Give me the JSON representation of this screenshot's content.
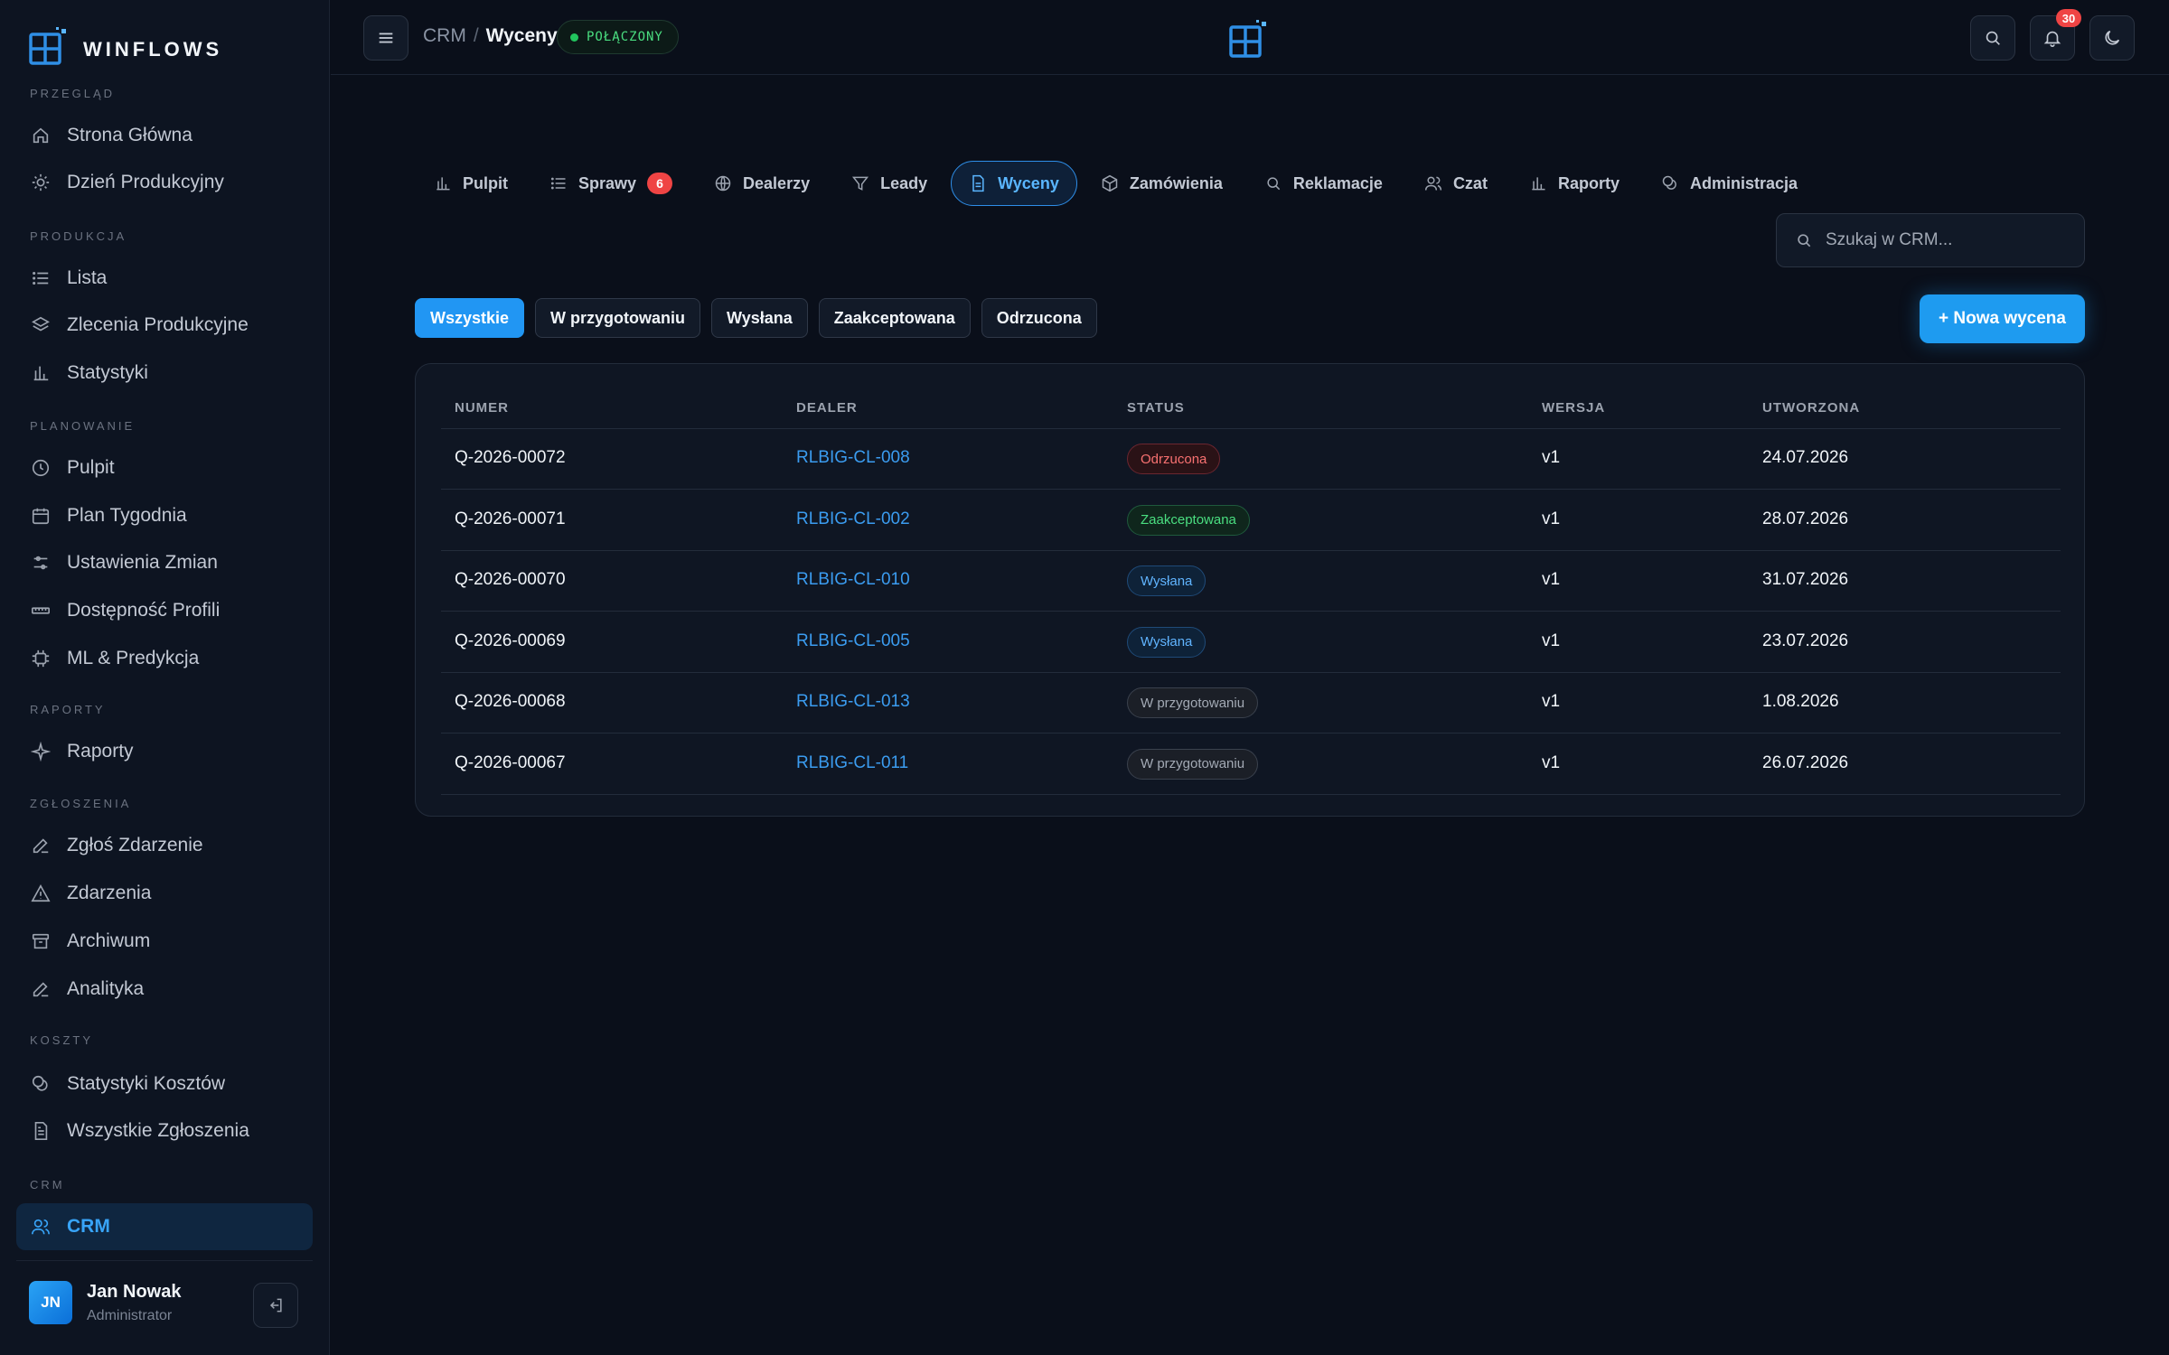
{
  "brand": {
    "name": "WINFLOWS"
  },
  "sidebar": {
    "sections": [
      {
        "label": "PRZEGLĄD",
        "items": [
          {
            "label": "Strona Główna",
            "icon": "home-icon"
          },
          {
            "label": "Dzień Produkcyjny",
            "icon": "sun-icon"
          }
        ]
      },
      {
        "label": "PRODUKCJA",
        "items": [
          {
            "label": "Lista",
            "icon": "list-icon"
          },
          {
            "label": "Zlecenia Produkcyjne",
            "icon": "layers-icon"
          },
          {
            "label": "Statystyki",
            "icon": "bar-chart-icon"
          }
        ]
      },
      {
        "label": "PLANOWANIE",
        "items": [
          {
            "label": "Pulpit",
            "icon": "clock-icon"
          },
          {
            "label": "Plan Tygodnia",
            "icon": "calendar-icon"
          },
          {
            "label": "Ustawienia Zmian",
            "icon": "sliders-icon"
          },
          {
            "label": "Dostępność Profili",
            "icon": "ruler-icon"
          },
          {
            "label": "ML & Predykcja",
            "icon": "cpu-icon"
          }
        ]
      },
      {
        "label": "RAPORTY",
        "items": [
          {
            "label": "Raporty",
            "icon": "sparkle-icon"
          }
        ]
      },
      {
        "label": "ZGŁOSZENIA",
        "items": [
          {
            "label": "Zgłoś Zdarzenie",
            "icon": "pencil-icon"
          },
          {
            "label": "Zdarzenia",
            "icon": "warning-icon"
          },
          {
            "label": "Archiwum",
            "icon": "archive-icon"
          },
          {
            "label": "Analityka",
            "icon": "pencil-icon"
          }
        ]
      },
      {
        "label": "KOSZTY",
        "items": [
          {
            "label": "Statystyki Kosztów",
            "icon": "coins-icon"
          },
          {
            "label": "Wszystkie Zgłoszenia",
            "icon": "file-icon"
          }
        ]
      },
      {
        "label": "CRM",
        "items": [
          {
            "label": "CRM",
            "icon": "users-icon",
            "active": true
          }
        ]
      }
    ],
    "user": {
      "initials": "JN",
      "name": "Jan Nowak",
      "role": "Administrator"
    }
  },
  "header": {
    "breadcrumb_root": "CRM",
    "breadcrumb_sep": "/",
    "breadcrumb_current": "Wyceny",
    "connection_status": "POŁĄCZONY",
    "notification_count": "30"
  },
  "tabs": [
    {
      "label": "Pulpit",
      "icon": "bar-chart-icon"
    },
    {
      "label": "Sprawy",
      "icon": "list-icon",
      "badge": "6"
    },
    {
      "label": "Dealerzy",
      "icon": "globe-icon"
    },
    {
      "label": "Leady",
      "icon": "filter-icon"
    },
    {
      "label": "Wyceny",
      "icon": "document-icon",
      "active": true
    },
    {
      "label": "Zamówienia",
      "icon": "box-icon"
    },
    {
      "label": "Reklamacje",
      "icon": "search-icon"
    },
    {
      "label": "Czat",
      "icon": "users-icon"
    },
    {
      "label": "Raporty",
      "icon": "bar-chart-icon"
    },
    {
      "label": "Administracja",
      "icon": "coins-icon"
    }
  ],
  "search": {
    "placeholder": "Szukaj w CRM..."
  },
  "filters": [
    {
      "label": "Wszystkie",
      "active": true
    },
    {
      "label": "W przygotowaniu"
    },
    {
      "label": "Wysłana"
    },
    {
      "label": "Zaakceptowana"
    },
    {
      "label": "Odrzucona"
    }
  ],
  "new_button": "+ Nowa wycena",
  "table": {
    "columns": [
      "NUMER",
      "DEALER",
      "STATUS",
      "WERSJA",
      "UTWORZONA"
    ],
    "rows": [
      {
        "number": "Q-2026-00072",
        "dealer": "RLBIG-CL-008",
        "status": "Odrzucona",
        "status_kind": "rejected",
        "version": "v1",
        "created": "24.07.2026"
      },
      {
        "number": "Q-2026-00071",
        "dealer": "RLBIG-CL-002",
        "status": "Zaakceptowana",
        "status_kind": "accepted",
        "version": "v1",
        "created": "28.07.2026"
      },
      {
        "number": "Q-2026-00070",
        "dealer": "RLBIG-CL-010",
        "status": "Wysłana",
        "status_kind": "sent",
        "version": "v1",
        "created": "31.07.2026"
      },
      {
        "number": "Q-2026-00069",
        "dealer": "RLBIG-CL-005",
        "status": "Wysłana",
        "status_kind": "sent",
        "version": "v1",
        "created": "23.07.2026"
      },
      {
        "number": "Q-2026-00068",
        "dealer": "RLBIG-CL-013",
        "status": "W przygotowaniu",
        "status_kind": "draft",
        "version": "v1",
        "created": "1.08.2026"
      },
      {
        "number": "Q-2026-00067",
        "dealer": "RLBIG-CL-011",
        "status": "W przygotowaniu",
        "status_kind": "draft",
        "version": "v1",
        "created": "26.07.2026"
      }
    ]
  },
  "colors": {
    "accent": "#1e9bf0",
    "background": "#0a0f1a",
    "sidebar": "#0d1421",
    "status_rejected": "#f87171",
    "status_accepted": "#4ade80",
    "status_sent": "#60b4ff",
    "status_draft": "#a3aab5"
  }
}
